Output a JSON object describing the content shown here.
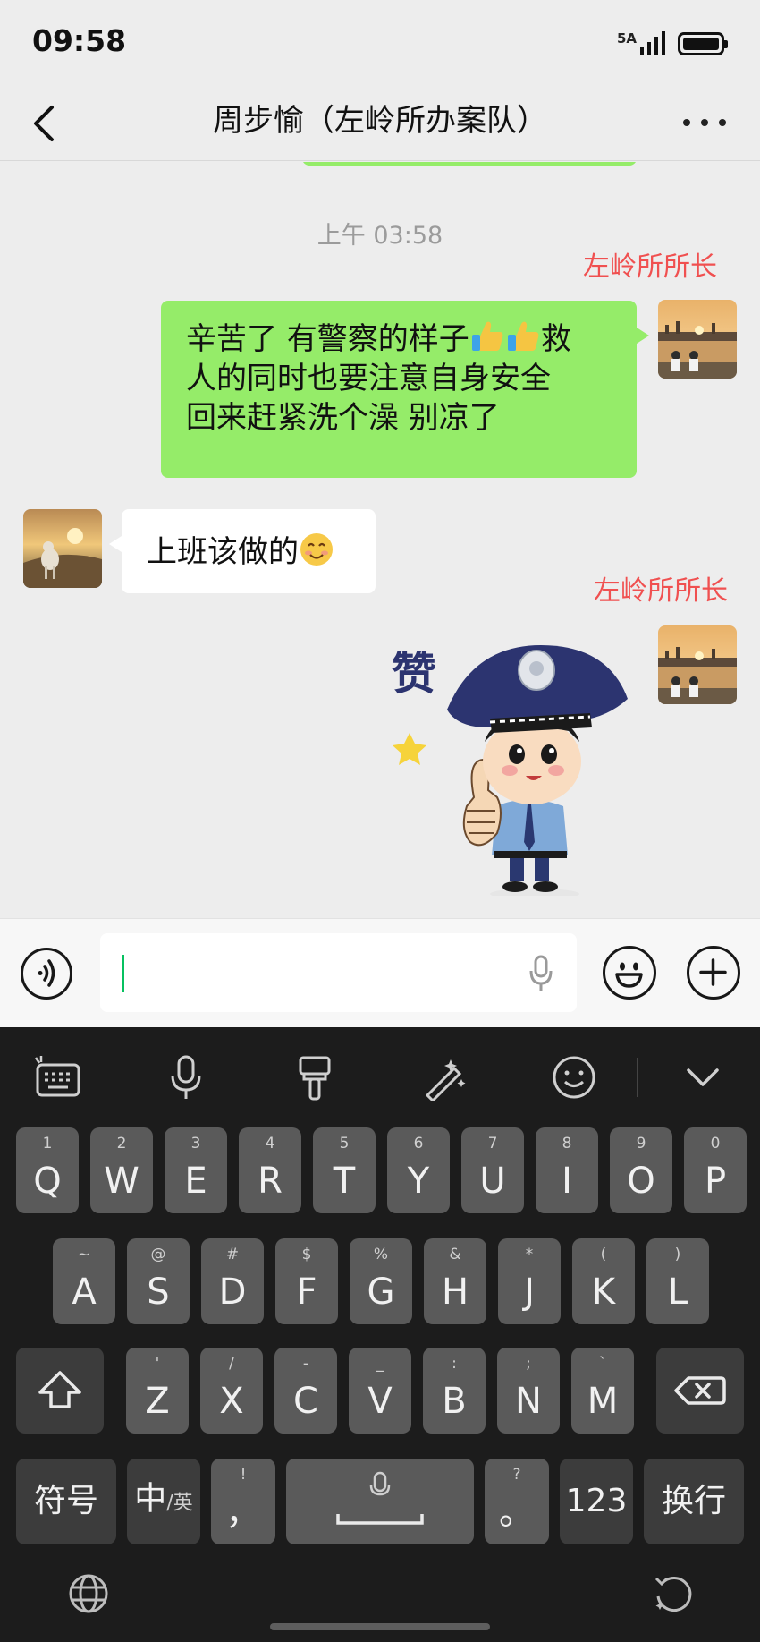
{
  "status_bar": {
    "time": "09:58",
    "network": "5A"
  },
  "header": {
    "title": "周步愉（左岭所办案队）"
  },
  "chat": {
    "timestamp": "上午 03:58",
    "messages": [
      {
        "sender": "左岭所所长",
        "side": "right",
        "lines": [
          "辛苦了 有警察的样子",
          "救",
          "人的同时也要注意自身安全",
          "回来赶紧洗个澡 别凉了"
        ],
        "emoji": "thumbs-up-icon"
      },
      {
        "side": "left",
        "text": "上班该做的",
        "emoji": "smiling-face-icon"
      },
      {
        "sender": "左岭所所长",
        "side": "right",
        "sticker": {
          "caption": "赞",
          "name": "police-thumbs-up-sticker"
        }
      }
    ]
  },
  "input": {
    "value": ""
  },
  "keyboard": {
    "toolbar": [
      "keyboard-settings-icon",
      "voice-input-icon",
      "theme-brush-icon",
      "magic-pen-icon",
      "emoji-icon",
      "collapse-chevron-icon"
    ],
    "row1": [
      {
        "main": "Q",
        "sub": "1"
      },
      {
        "main": "W",
        "sub": "2"
      },
      {
        "main": "E",
        "sub": "3"
      },
      {
        "main": "R",
        "sub": "4"
      },
      {
        "main": "T",
        "sub": "5"
      },
      {
        "main": "Y",
        "sub": "6"
      },
      {
        "main": "U",
        "sub": "7"
      },
      {
        "main": "I",
        "sub": "8"
      },
      {
        "main": "O",
        "sub": "9"
      },
      {
        "main": "P",
        "sub": "0"
      }
    ],
    "row2": [
      {
        "main": "A",
        "sub": "~"
      },
      {
        "main": "S",
        "sub": "@"
      },
      {
        "main": "D",
        "sub": "#"
      },
      {
        "main": "F",
        "sub": "$"
      },
      {
        "main": "G",
        "sub": "%"
      },
      {
        "main": "H",
        "sub": "&"
      },
      {
        "main": "J",
        "sub": "*"
      },
      {
        "main": "K",
        "sub": "("
      },
      {
        "main": "L",
        "sub": ")"
      }
    ],
    "row3": [
      {
        "main": "Z",
        "sub": "'"
      },
      {
        "main": "X",
        "sub": "/"
      },
      {
        "main": "C",
        "sub": "-"
      },
      {
        "main": "V",
        "sub": "_"
      },
      {
        "main": "B",
        "sub": ":"
      },
      {
        "main": "N",
        "sub": ";"
      },
      {
        "main": "M",
        "sub": "`"
      }
    ],
    "symbols_label": "符号",
    "lang_main": "中",
    "lang_sub": "/英",
    "comma_main": "，",
    "comma_sub": "!",
    "period_main": "。",
    "period_sub": "?",
    "numbers_label": "123",
    "enter_label": "换行"
  }
}
